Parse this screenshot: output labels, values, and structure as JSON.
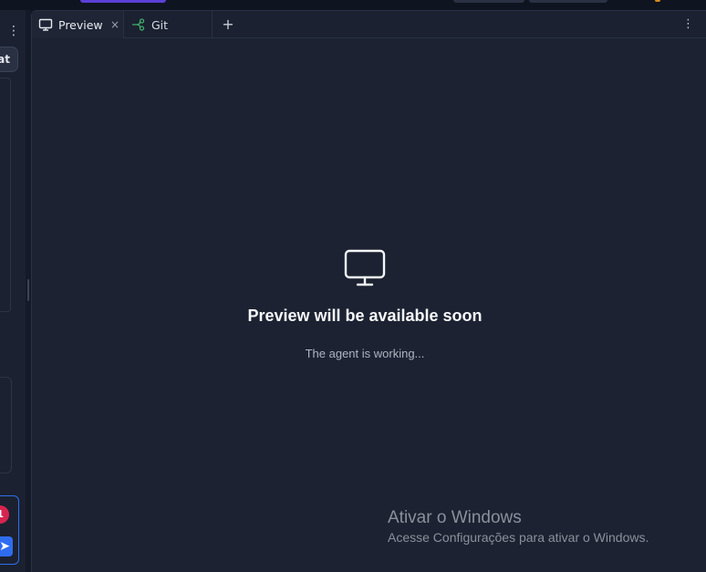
{
  "top": {
    "accent": "#5b3fd6"
  },
  "left": {
    "chat_label": "at",
    "badge": "1",
    "send_icon": "send-icon"
  },
  "tabs": [
    {
      "label": "Preview",
      "icon": "monitor-icon",
      "active": true
    },
    {
      "label": "Git",
      "icon": "git-branch-icon",
      "active": false
    }
  ],
  "tab_close": "×",
  "tab_add": "+",
  "menu": "⋮",
  "preview": {
    "icon": "monitor-icon",
    "title": "Preview will be available soon",
    "subtitle": "The agent is working..."
  },
  "watermark": {
    "title": "Ativar o Windows",
    "subtitle": "Acesse Configurações para ativar o Windows."
  },
  "colors": {
    "background": "#1c2231",
    "sidebar": "#1b2130",
    "git_icon": "#3fae6b",
    "send_button": "#2f6df0",
    "badge": "#d62450"
  }
}
